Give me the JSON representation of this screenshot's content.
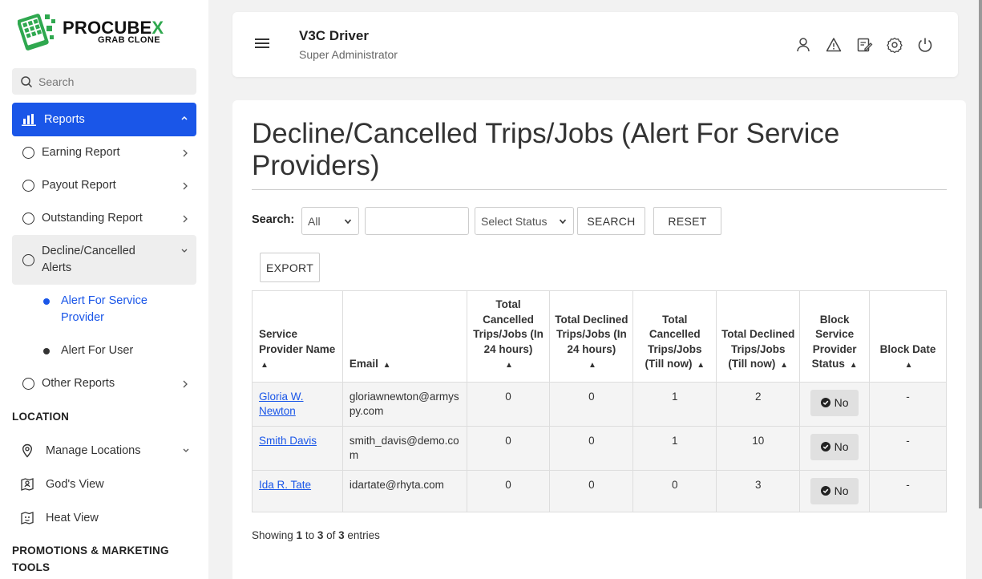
{
  "app": {
    "logo_title_a": "PRO",
    "logo_title_b": "CUBE",
    "logo_title_c": "X",
    "logo_sub": "GRAB CLONE"
  },
  "colors": {
    "accent": "#1a56e8",
    "logo_green": "#2fa84f"
  },
  "sidebar": {
    "search_placeholder": "Search",
    "active_item": "Reports",
    "items": [
      {
        "label": "Earning Report"
      },
      {
        "label": "Payout Report"
      },
      {
        "label": "Outstanding Report"
      },
      {
        "label": "Decline/Cancelled Alerts"
      },
      {
        "label": "Other Reports"
      }
    ],
    "sub_items": [
      {
        "label": "Alert For Service Provider",
        "active": true
      },
      {
        "label": "Alert For User",
        "active": false
      }
    ],
    "location_heading": "LOCATION",
    "location_items": [
      {
        "label": "Manage Locations",
        "icon": "map-pin-icon"
      },
      {
        "label": "God's View",
        "icon": "map-user-icon"
      },
      {
        "label": "Heat View",
        "icon": "heat-map-icon"
      }
    ],
    "promo_heading": "PROMOTIONS & MARKETING TOOLS"
  },
  "header": {
    "title": "V3C Driver",
    "subtitle": "Super Administrator",
    "icons": [
      "user-icon",
      "alert-icon",
      "edit-icon",
      "settings-icon",
      "power-icon"
    ]
  },
  "main": {
    "page_title": "Decline/Cancelled Trips/Jobs (Alert For Service Providers)",
    "search_label": "Search:",
    "filter_select": "All",
    "keyword_value": "",
    "status_select": "Select Status",
    "search_button": "SEARCH",
    "reset_button": "RESET",
    "export_button": "EXPORT",
    "columns": [
      "Service Provider Name",
      "Email",
      "Total Cancelled Trips/Jobs (In 24 hours)",
      "Total Declined Trips/Jobs (In 24 hours)",
      "Total Cancelled Trips/Jobs (Till now)",
      "Total Declined Trips/Jobs (Till now)",
      "Block Service Provider Status",
      "Block Date"
    ],
    "rows": [
      {
        "name": "Gloria W. Newton",
        "email": "gloriawnewton@armyspy.com",
        "c24": "0",
        "d24": "0",
        "ctotal": "1",
        "dtotal": "2",
        "status": "No",
        "block_date": "-"
      },
      {
        "name": "Smith Davis",
        "email": "smith_davis@demo.com",
        "c24": "0",
        "d24": "0",
        "ctotal": "1",
        "dtotal": "10",
        "status": "No",
        "block_date": "-"
      },
      {
        "name": "Ida R. Tate",
        "email": "idartate@rhyta.com",
        "c24": "0",
        "d24": "0",
        "ctotal": "0",
        "dtotal": "3",
        "status": "No",
        "block_date": "-"
      }
    ],
    "showing": {
      "prefix": "Showing ",
      "from": "1",
      "to_word": " to ",
      "to": "3",
      "of_word": " of ",
      "total": "3",
      "suffix": " entries"
    }
  }
}
